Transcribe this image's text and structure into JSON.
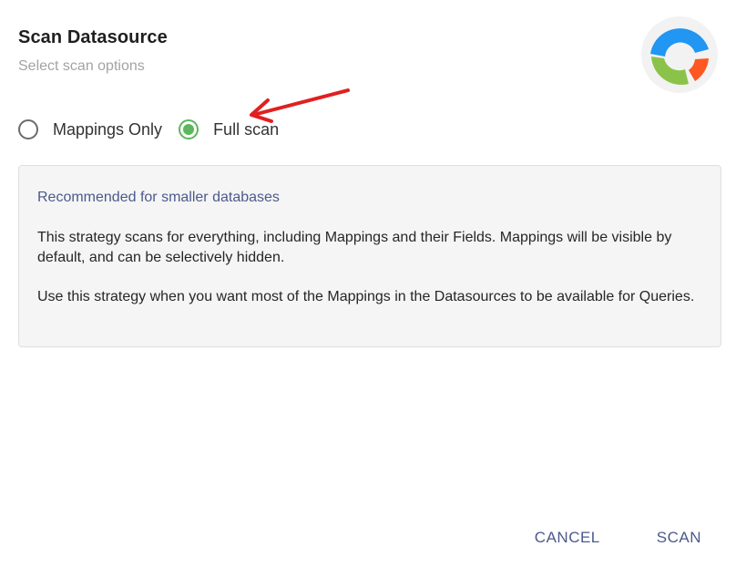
{
  "dialog": {
    "title": "Scan Datasource",
    "subtitle": "Select scan options"
  },
  "logo": {
    "icon": "datasource-ring-logo-icon",
    "colors": [
      "#2196f3",
      "#8bc34a",
      "#ff5722"
    ]
  },
  "annotation": {
    "icon": "red-arrow-icon",
    "color": "#e02020"
  },
  "scan_options": [
    {
      "label": "Mappings Only",
      "selected": false
    },
    {
      "label": "Full scan",
      "selected": true
    }
  ],
  "info": {
    "heading": "Recommended for smaller databases",
    "paragraph_1": "This strategy scans for everything, including Mappings and their Fields. Mappings will be visible by default, and can be selectively hidden.",
    "paragraph_2": "Use this strategy when you want most of the Mappings in the Datasources to be available for Queries."
  },
  "actions": {
    "cancel_label": "CANCEL",
    "scan_label": "SCAN"
  },
  "colors": {
    "accent": "#4b5a8c",
    "radio_selected": "#5cb85c"
  }
}
